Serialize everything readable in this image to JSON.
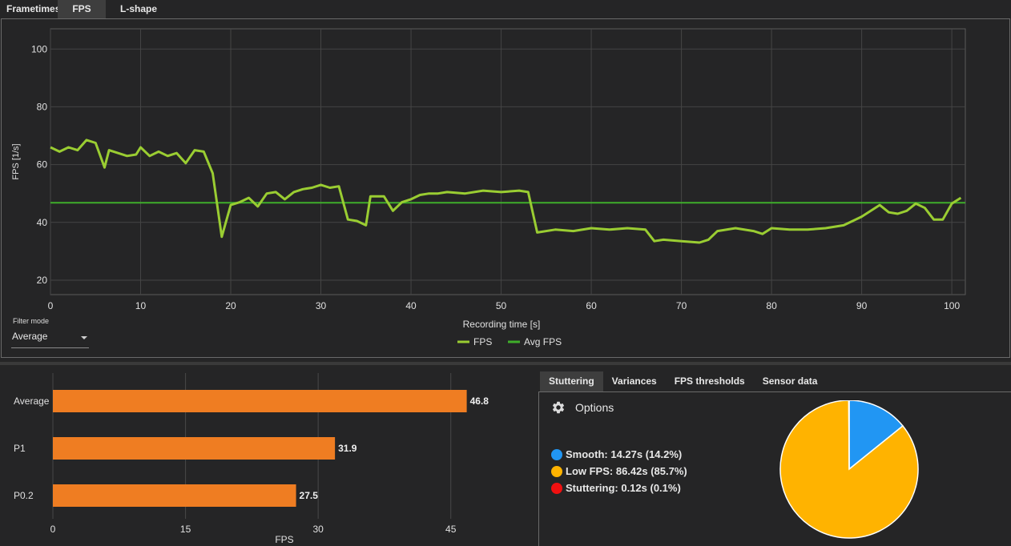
{
  "top_tabs": {
    "frametimes": "Frametimes",
    "fps": "FPS",
    "lshape": "L-shape"
  },
  "fps_chart": {
    "type": "line",
    "ylabel": "FPS [1/s]",
    "xlabel": "Recording time [s]",
    "xlim": [
      0,
      101.5
    ],
    "ylim": [
      15,
      107
    ],
    "x_ticks": [
      "0",
      "10",
      "20",
      "30",
      "40",
      "50",
      "60",
      "70",
      "80",
      "90",
      "100"
    ],
    "y_ticks": [
      "20",
      "40",
      "60",
      "80",
      "100"
    ],
    "grid": true,
    "legend_position": "bottom-center",
    "series": [
      {
        "name": "FPS",
        "color": "#9acd32",
        "points": [
          [
            0,
            66
          ],
          [
            1,
            64.5
          ],
          [
            2,
            66
          ],
          [
            3,
            65
          ],
          [
            4,
            68.5
          ],
          [
            5,
            67.5
          ],
          [
            6,
            59
          ],
          [
            6.5,
            65
          ],
          [
            7.5,
            64
          ],
          [
            8.5,
            63
          ],
          [
            9.5,
            63.5
          ],
          [
            10,
            66
          ],
          [
            11,
            63
          ],
          [
            12,
            64.5
          ],
          [
            13,
            63
          ],
          [
            14,
            64
          ],
          [
            15,
            60.5
          ],
          [
            16,
            65
          ],
          [
            17,
            64.5
          ],
          [
            18,
            57
          ],
          [
            19,
            35
          ],
          [
            20,
            46
          ],
          [
            21,
            47
          ],
          [
            22,
            48.5
          ],
          [
            23,
            45.5
          ],
          [
            24,
            50
          ],
          [
            25,
            50.5
          ],
          [
            26,
            48
          ],
          [
            27,
            50.5
          ],
          [
            28,
            51.5
          ],
          [
            29,
            52
          ],
          [
            30,
            53
          ],
          [
            31,
            52
          ],
          [
            32,
            52.5
          ],
          [
            33,
            41
          ],
          [
            34,
            40.5
          ],
          [
            35,
            39
          ],
          [
            35.5,
            49
          ],
          [
            37,
            49
          ],
          [
            38,
            44
          ],
          [
            39,
            47
          ],
          [
            40,
            48
          ],
          [
            41,
            49.5
          ],
          [
            42,
            50
          ],
          [
            43,
            50
          ],
          [
            44,
            50.5
          ],
          [
            46,
            50
          ],
          [
            48,
            51
          ],
          [
            50,
            50.5
          ],
          [
            52,
            51
          ],
          [
            53,
            50.5
          ],
          [
            54,
            36.5
          ],
          [
            56,
            37.5
          ],
          [
            58,
            37
          ],
          [
            60,
            38
          ],
          [
            62,
            37.5
          ],
          [
            64,
            38
          ],
          [
            66,
            37.5
          ],
          [
            67,
            33.5
          ],
          [
            68,
            34
          ],
          [
            70,
            33.5
          ],
          [
            72,
            33
          ],
          [
            73,
            34
          ],
          [
            74,
            37
          ],
          [
            76,
            38
          ],
          [
            78,
            37
          ],
          [
            79,
            36
          ],
          [
            80,
            38
          ],
          [
            82,
            37.5
          ],
          [
            84,
            37.5
          ],
          [
            86,
            38
          ],
          [
            88,
            39
          ],
          [
            89,
            40.5
          ],
          [
            90,
            42
          ],
          [
            92,
            46
          ],
          [
            93,
            43.5
          ],
          [
            94,
            43
          ],
          [
            95,
            44
          ],
          [
            96,
            46.5
          ],
          [
            97,
            45
          ],
          [
            98,
            41
          ],
          [
            99,
            41
          ],
          [
            100,
            46.5
          ],
          [
            101,
            48.5
          ]
        ]
      },
      {
        "name": "Avg FPS",
        "color": "#3fae2a",
        "value": 46.8
      }
    ]
  },
  "filter": {
    "label": "Filter mode",
    "value": "Average"
  },
  "bar_chart": {
    "type": "bar",
    "orientation": "horizontal",
    "categories": [
      "Average",
      "P1",
      "P0.2"
    ],
    "values": [
      46.8,
      31.9,
      27.5
    ],
    "value_labels": [
      "46.8",
      "31.9",
      "27.5"
    ],
    "xlabel": "FPS",
    "xlim": [
      0,
      52
    ],
    "x_ticks": [
      "0",
      "15",
      "30",
      "45"
    ],
    "bar_color": "#ef7d22"
  },
  "right_tabs": [
    "Stuttering",
    "Variances",
    "FPS thresholds",
    "Sensor data"
  ],
  "options": {
    "label": "Options",
    "icon": "gear-icon"
  },
  "stutter_legend": [
    {
      "name": "Smooth:",
      "text": "14.27s (14.2%)",
      "color": "#2196f3"
    },
    {
      "name": "Low FPS:",
      "text": "86.42s (85.7%)",
      "color": "#ffb300"
    },
    {
      "name": "Stuttering:",
      "text": "0.12s (0.1%)",
      "color": "#f01010"
    }
  ],
  "pie_chart": {
    "type": "pie",
    "values": [
      14.2,
      85.7,
      0.1
    ],
    "labels": [
      "Smooth",
      "Low FPS",
      "Stuttering"
    ],
    "colors": [
      "#2196f3",
      "#ffb300",
      "#f01010"
    ],
    "start_angle": "12 o'clock, clockwise"
  }
}
